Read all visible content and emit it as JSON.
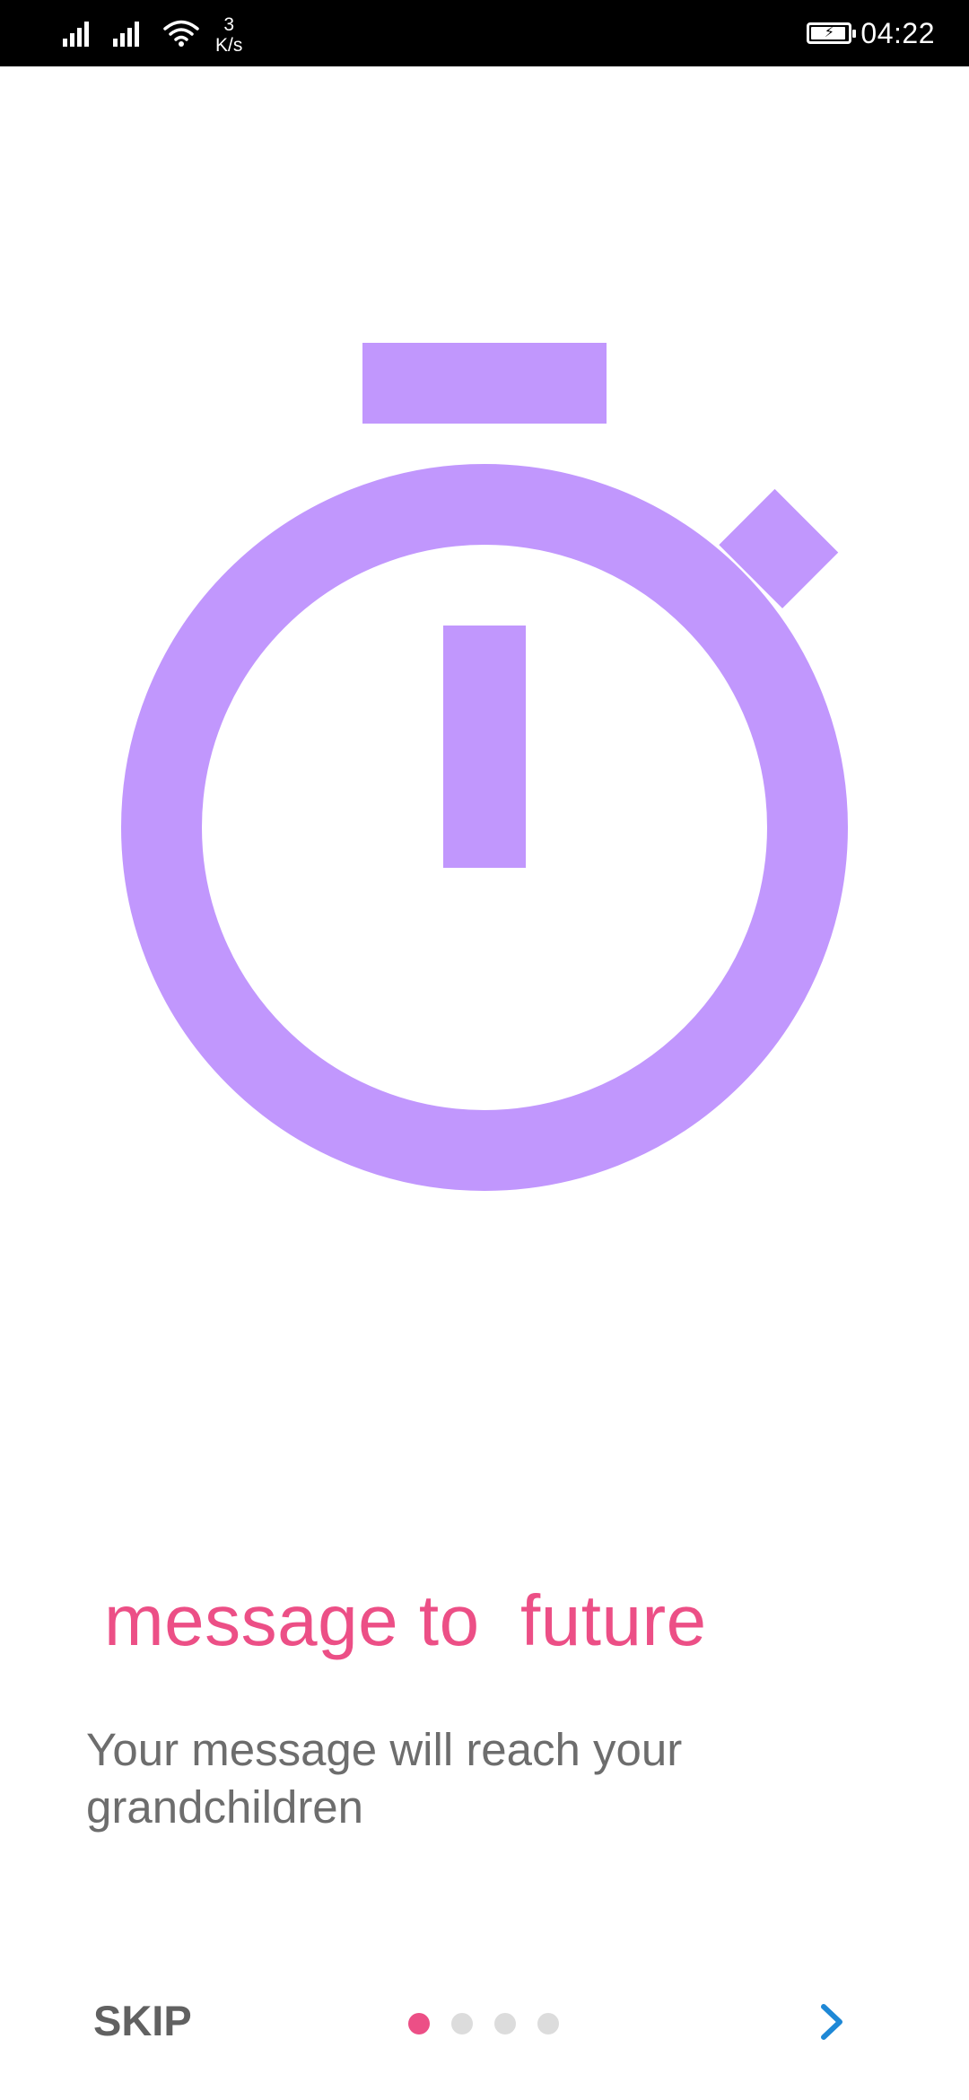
{
  "status_bar": {
    "network_speed_value": "3",
    "network_speed_unit": "K/s",
    "time": "04:22",
    "icons": [
      "signal-icon",
      "signal-icon",
      "wifi-icon",
      "battery-charging-icon"
    ],
    "battery_level": 0.95
  },
  "illustration": {
    "icon": "stopwatch-icon",
    "color": "#c197fd"
  },
  "onboarding": {
    "title": "message to  future",
    "description": "Your message will reach your grandchildren",
    "title_color": "#ec4f86",
    "description_color": "#6d6d6d"
  },
  "navigation": {
    "skip_label": "SKIP",
    "page_count": 4,
    "current_page": 1,
    "next_icon": "chevron-right-icon",
    "active_dot_color": "#ec4f86",
    "inactive_dot_color": "#dcdcdc",
    "next_color": "#1e88d6"
  }
}
